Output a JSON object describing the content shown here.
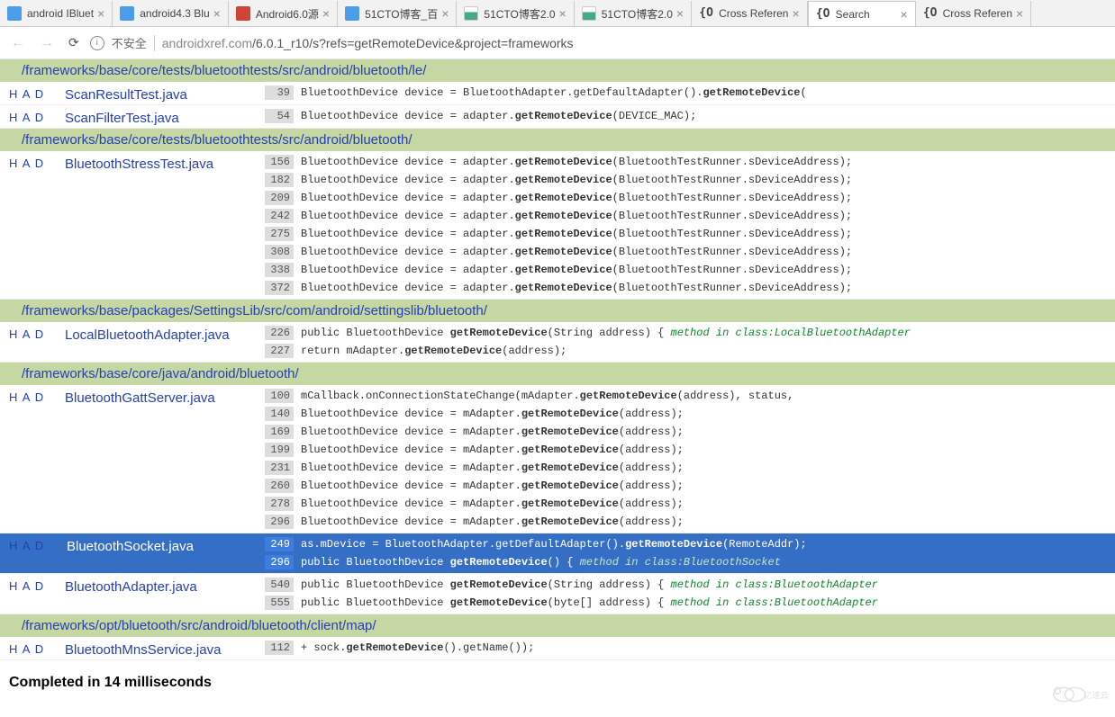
{
  "tabs": [
    {
      "title": "android IBluet",
      "fav": "fav-blue"
    },
    {
      "title": "android4.3 Blu",
      "fav": "fav-blue"
    },
    {
      "title": "Android6.0源",
      "fav": "fav-red"
    },
    {
      "title": "51CTO博客_百",
      "fav": "fav-blue"
    },
    {
      "title": "51CTO博客2.0",
      "fav": "fav-bar"
    },
    {
      "title": "51CTO博客2.0",
      "fav": "fav-bar"
    },
    {
      "title": "Cross Referen",
      "fav": "fav-brace",
      "glyph": "{O"
    },
    {
      "title": "Search",
      "fav": "fav-brace",
      "glyph": "{O",
      "active": true
    },
    {
      "title": "Cross Referen",
      "fav": "fav-brace",
      "glyph": "{O"
    }
  ],
  "address": {
    "insecure_label": "不安全",
    "host": "androidxref.com",
    "path": "/6.0.1_r10/s?refs=getRemoteDevice&project=frameworks"
  },
  "had": {
    "h": "H",
    "a": "A",
    "d": "D"
  },
  "results": [
    {
      "type": "dir",
      "path": "/frameworks/base/core/tests/bluetoothtests/src/android/bluetooth/le/"
    },
    {
      "type": "file",
      "fname": "ScanResultTest.java",
      "lines": [
        {
          "ln": "39",
          "pre": "BluetoothDevice device = BluetoothAdapter.getDefaultAdapter().",
          "bold": "getRemoteDevice",
          "post": "("
        }
      ]
    },
    {
      "type": "file",
      "fname": "ScanFilterTest.java",
      "lines": [
        {
          "ln": "54",
          "pre": "BluetoothDevice device = adapter.",
          "bold": "getRemoteDevice",
          "post": "(DEVICE_MAC);"
        }
      ]
    },
    {
      "type": "dir",
      "path": "/frameworks/base/core/tests/bluetoothtests/src/android/bluetooth/"
    },
    {
      "type": "file",
      "fname": "BluetoothStressTest.java",
      "lines": [
        {
          "ln": "156",
          "pre": "BluetoothDevice device = adapter.",
          "bold": "getRemoteDevice",
          "post": "(BluetoothTestRunner.sDeviceAddress);"
        },
        {
          "ln": "182",
          "pre": "BluetoothDevice device = adapter.",
          "bold": "getRemoteDevice",
          "post": "(BluetoothTestRunner.sDeviceAddress);"
        },
        {
          "ln": "209",
          "pre": "BluetoothDevice device = adapter.",
          "bold": "getRemoteDevice",
          "post": "(BluetoothTestRunner.sDeviceAddress);"
        },
        {
          "ln": "242",
          "pre": "BluetoothDevice device = adapter.",
          "bold": "getRemoteDevice",
          "post": "(BluetoothTestRunner.sDeviceAddress);"
        },
        {
          "ln": "275",
          "pre": "BluetoothDevice device = adapter.",
          "bold": "getRemoteDevice",
          "post": "(BluetoothTestRunner.sDeviceAddress);"
        },
        {
          "ln": "308",
          "pre": "BluetoothDevice device = adapter.",
          "bold": "getRemoteDevice",
          "post": "(BluetoothTestRunner.sDeviceAddress);"
        },
        {
          "ln": "338",
          "pre": "BluetoothDevice device = adapter.",
          "bold": "getRemoteDevice",
          "post": "(BluetoothTestRunner.sDeviceAddress);"
        },
        {
          "ln": "372",
          "pre": "BluetoothDevice device = adapter.",
          "bold": "getRemoteDevice",
          "post": "(BluetoothTestRunner.sDeviceAddress);"
        }
      ]
    },
    {
      "type": "dir",
      "path": "/frameworks/base/packages/SettingsLib/src/com/android/settingslib/bluetooth/"
    },
    {
      "type": "file",
      "fname": "LocalBluetoothAdapter.java",
      "lines": [
        {
          "ln": "226",
          "pre": "public BluetoothDevice ",
          "bold": "getRemoteDevice",
          "post": "(String address) {  ",
          "note": "method in class:LocalBluetoothAdapter"
        },
        {
          "ln": "227",
          "pre": "return mAdapter.",
          "bold": "getRemoteDevice",
          "post": "(address);"
        }
      ]
    },
    {
      "type": "dir",
      "path": "/frameworks/base/core/java/android/bluetooth/"
    },
    {
      "type": "file",
      "fname": "BluetoothGattServer.java",
      "lines": [
        {
          "ln": "100",
          "pre": "mCallback.onConnectionStateChange(mAdapter.",
          "bold": "getRemoteDevice",
          "post": "(address), status,"
        },
        {
          "ln": "140",
          "pre": "BluetoothDevice device = mAdapter.",
          "bold": "getRemoteDevice",
          "post": "(address);"
        },
        {
          "ln": "169",
          "pre": "BluetoothDevice device = mAdapter.",
          "bold": "getRemoteDevice",
          "post": "(address);"
        },
        {
          "ln": "199",
          "pre": "BluetoothDevice device = mAdapter.",
          "bold": "getRemoteDevice",
          "post": "(address);"
        },
        {
          "ln": "231",
          "pre": "BluetoothDevice device = mAdapter.",
          "bold": "getRemoteDevice",
          "post": "(address);"
        },
        {
          "ln": "260",
          "pre": "BluetoothDevice device = mAdapter.",
          "bold": "getRemoteDevice",
          "post": "(address);"
        },
        {
          "ln": "278",
          "pre": "BluetoothDevice device = mAdapter.",
          "bold": "getRemoteDevice",
          "post": "(address);"
        },
        {
          "ln": "296",
          "pre": "BluetoothDevice device = mAdapter.",
          "bold": "getRemoteDevice",
          "post": "(address);"
        }
      ]
    },
    {
      "type": "file",
      "fname": "BluetoothSocket.java",
      "selected": true,
      "lines": [
        {
          "ln": "249",
          "pre": "as.mDevice = BluetoothAdapter.getDefaultAdapter().",
          "bold": "getRemoteDevice",
          "post": "(RemoteAddr);"
        },
        {
          "ln": "296",
          "pre": "public BluetoothDevice ",
          "bold": "getRemoteDevice",
          "post": "() {  ",
          "note": "method in class:BluetoothSocket"
        }
      ]
    },
    {
      "type": "file",
      "fname": "BluetoothAdapter.java",
      "lines": [
        {
          "ln": "540",
          "pre": "public BluetoothDevice ",
          "bold": "getRemoteDevice",
          "post": "(String address) {  ",
          "note": "method in class:BluetoothAdapter"
        },
        {
          "ln": "555",
          "pre": "public BluetoothDevice ",
          "bold": "getRemoteDevice",
          "post": "(byte[] address) {  ",
          "note": "method in class:BluetoothAdapter"
        }
      ]
    },
    {
      "type": "dir",
      "path": "/frameworks/opt/bluetooth/src/android/bluetooth/client/map/"
    },
    {
      "type": "file",
      "fname": "BluetoothMnsService.java",
      "lines": [
        {
          "ln": "112",
          "pre": "+ sock.",
          "bold": "getRemoteDevice",
          "post": "().getName());"
        }
      ]
    }
  ],
  "footer": "Completed in 14 milliseconds",
  "watermark": "亿速云"
}
